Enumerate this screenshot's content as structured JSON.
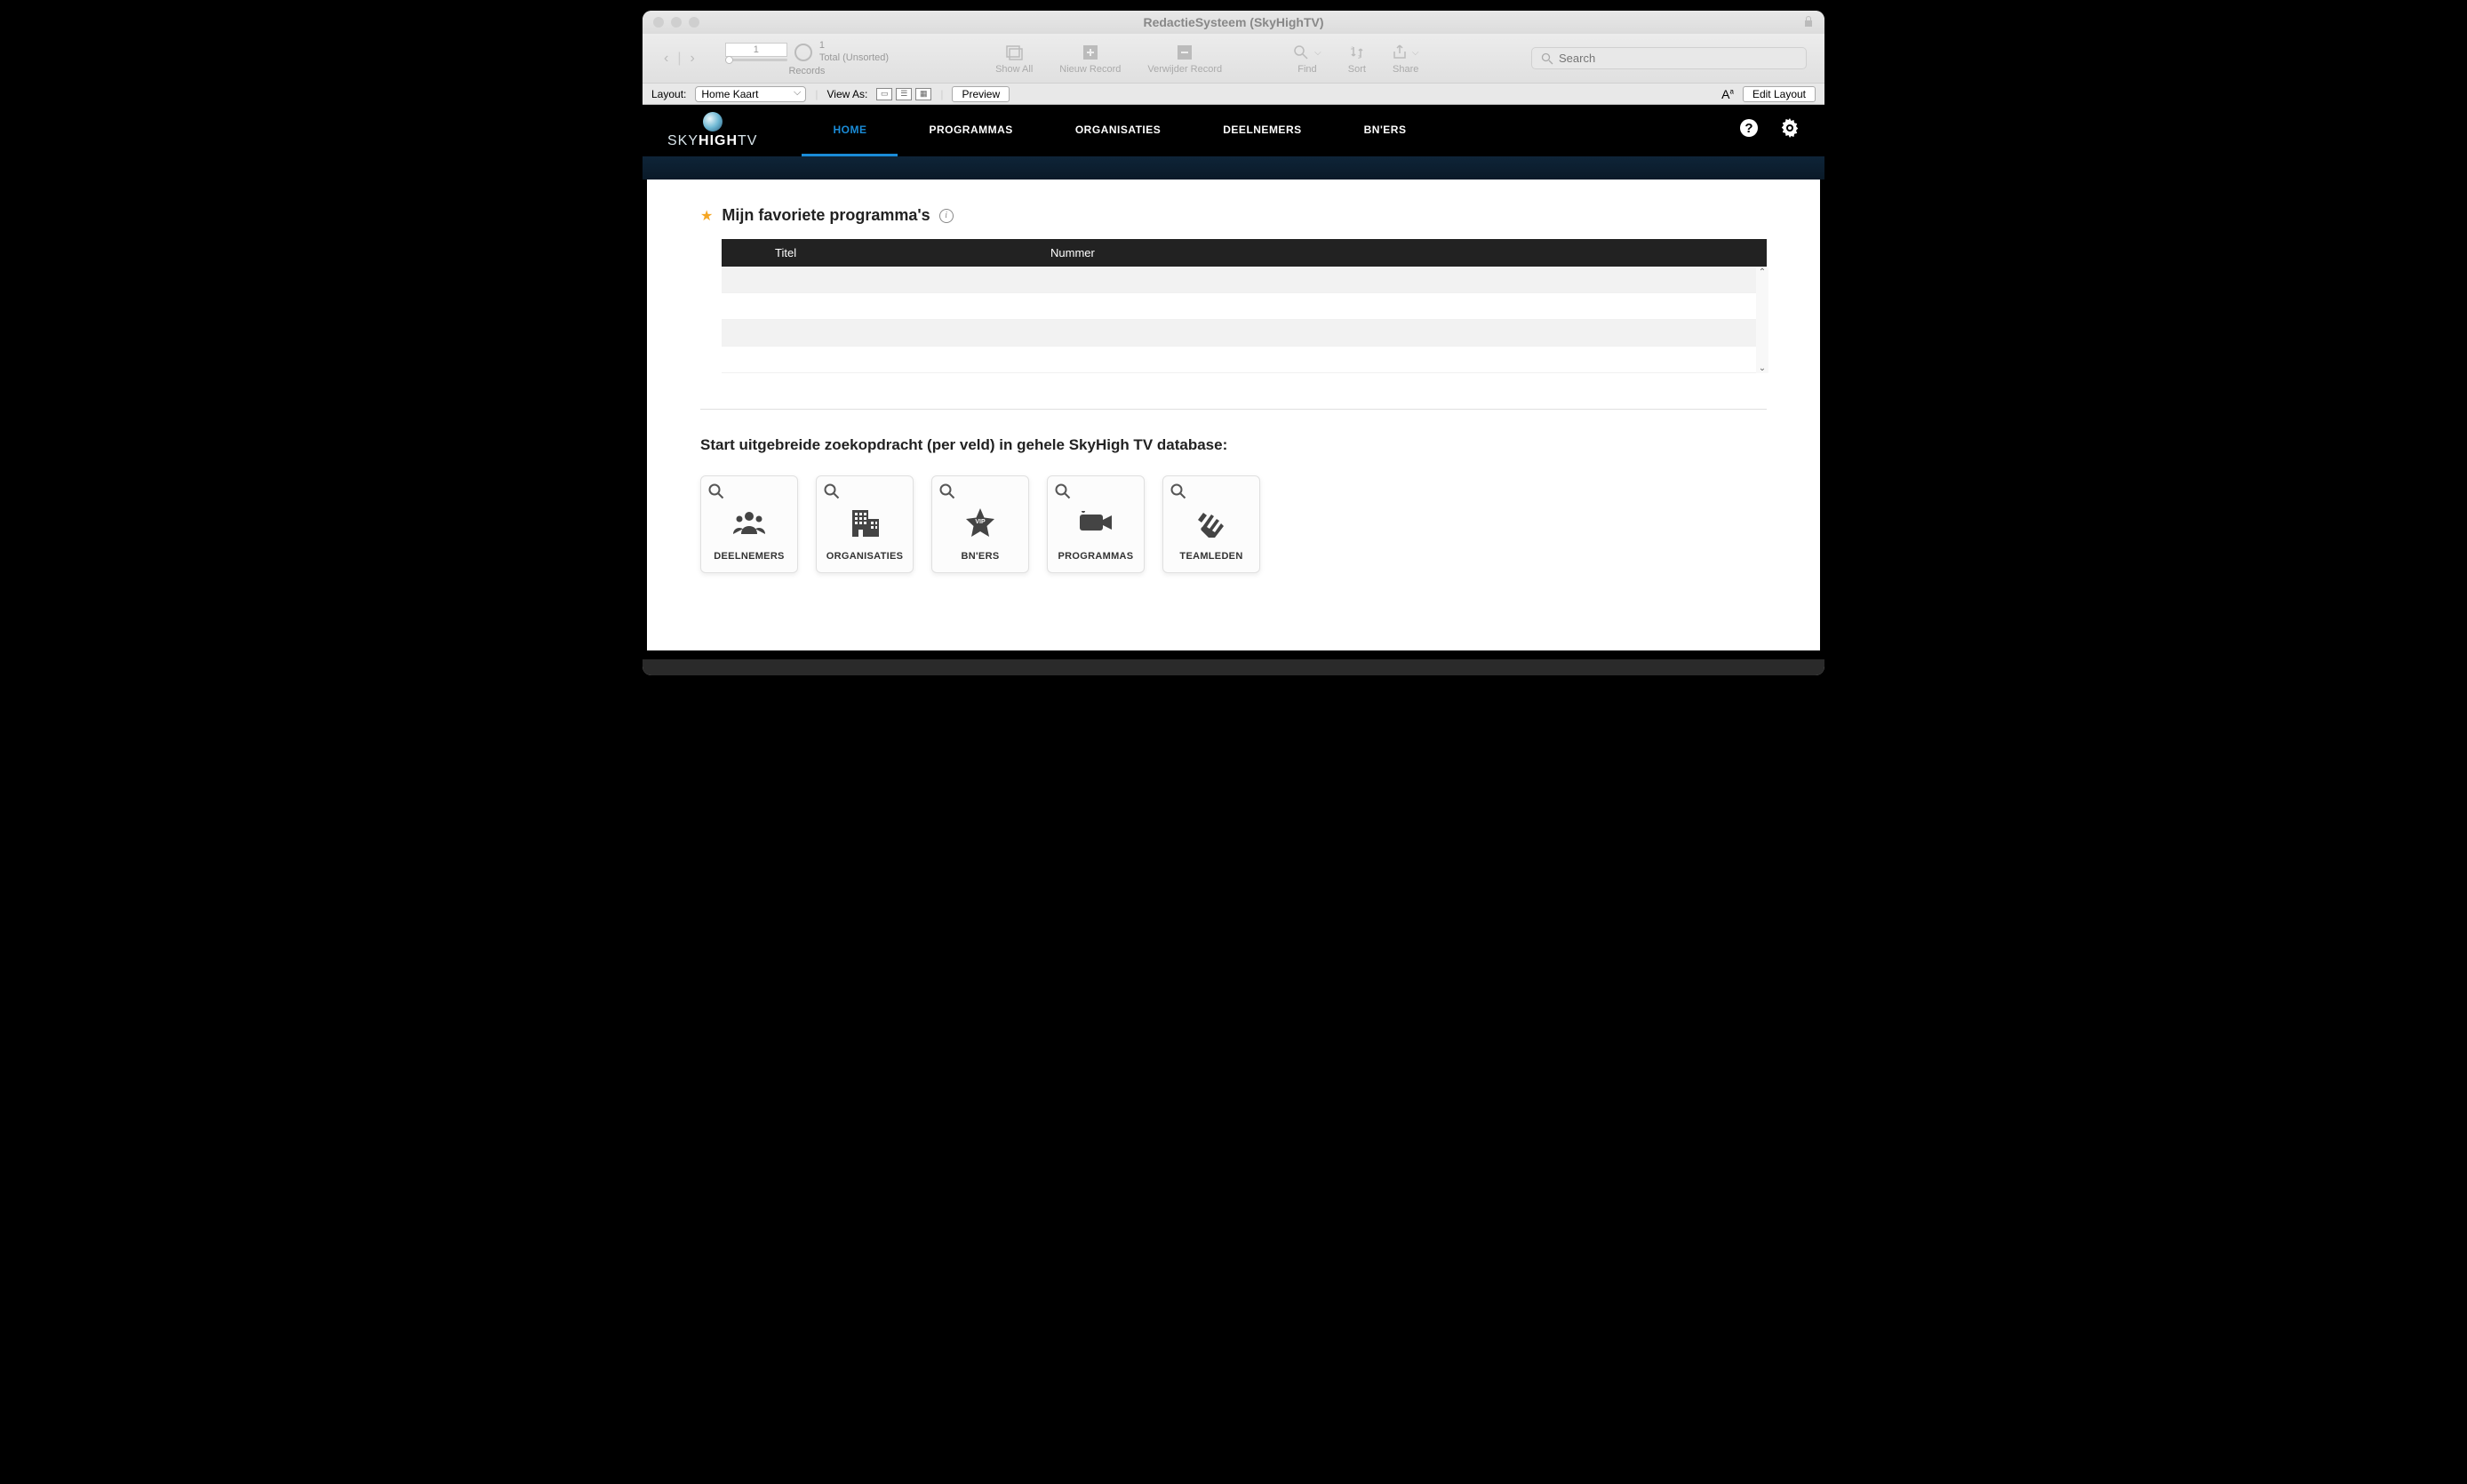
{
  "window": {
    "title": "RedactieSysteem (SkyHighTV)"
  },
  "toolbar": {
    "record_number": "1",
    "record_count": "1",
    "record_status": "Total (Unsorted)",
    "records_label": "Records",
    "show_all": "Show All",
    "new_record": "Nieuw Record",
    "delete_record": "Verwijder Record",
    "find": "Find",
    "sort": "Sort",
    "share": "Share",
    "search_placeholder": "Search"
  },
  "subbar": {
    "layout_label": "Layout:",
    "layout_value": "Home Kaart",
    "view_as": "View As:",
    "preview": "Preview",
    "text_format": "Aa",
    "edit_layout": "Edit Layout"
  },
  "logo": {
    "part1": "SKY",
    "part2": "HIGH",
    "part3": "TV"
  },
  "nav": {
    "items": [
      {
        "label": "HOME",
        "active": true
      },
      {
        "label": "PROGRAMMAS",
        "active": false
      },
      {
        "label": "ORGANISATIES",
        "active": false
      },
      {
        "label": "DEELNEMERS",
        "active": false
      },
      {
        "label": "BN'ERS",
        "active": false
      }
    ]
  },
  "favorites": {
    "title": "Mijn favoriete programma's",
    "columns": {
      "titel": "Titel",
      "nummer": "Nummer"
    }
  },
  "search_section": {
    "title": "Start uitgebreide zoekopdracht (per veld) in gehele SkyHigh TV database:",
    "cards": [
      {
        "label": "DEELNEMERS",
        "icon": "people"
      },
      {
        "label": "ORGANISATIES",
        "icon": "building"
      },
      {
        "label": "BN'ERS",
        "icon": "vip-star"
      },
      {
        "label": "PROGRAMMAS",
        "icon": "camera"
      },
      {
        "label": "TEAMLEDEN",
        "icon": "hands"
      }
    ]
  }
}
